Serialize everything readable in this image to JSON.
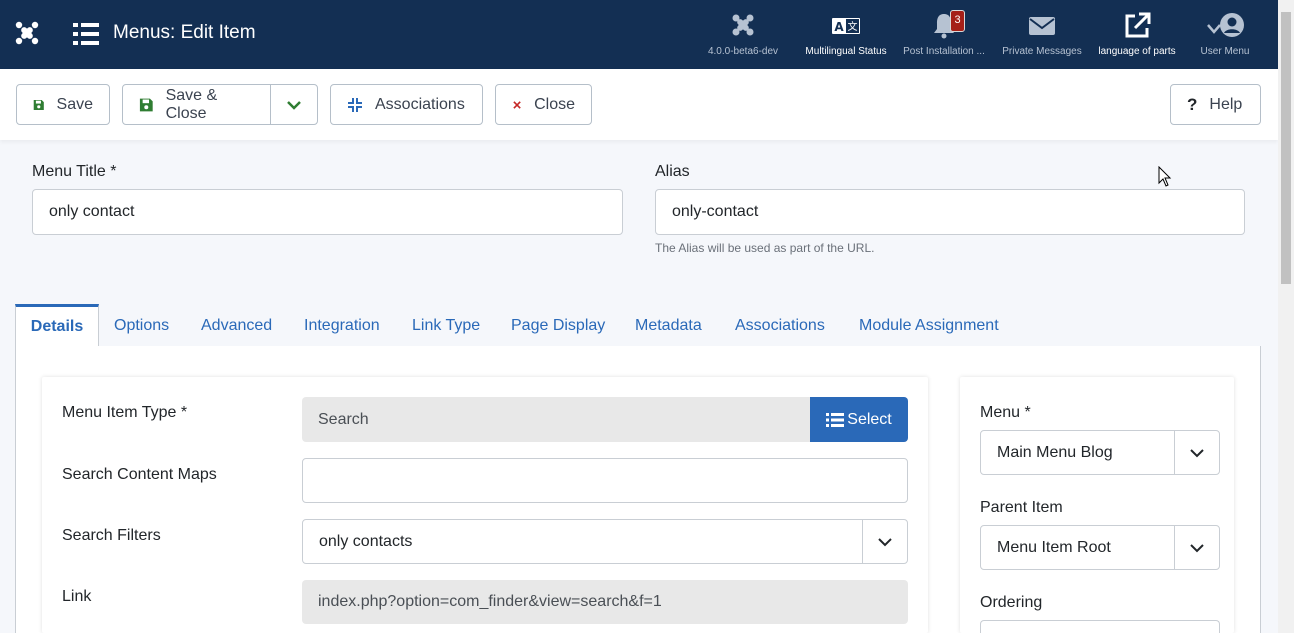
{
  "header": {
    "title": "Menus: Edit Item",
    "items": [
      {
        "label": "4.0.0-beta6-dev",
        "icon": "joomla-icon"
      },
      {
        "label": "Multilingual Status",
        "icon": "language-icon"
      },
      {
        "label": "Post Installation ...",
        "icon": "bell-icon",
        "badge": "3"
      },
      {
        "label": "Private Messages",
        "icon": "envelope-icon"
      },
      {
        "label": "language of parts",
        "icon": "external-link-icon"
      },
      {
        "label": "User Menu",
        "icon": "user-icon"
      }
    ]
  },
  "toolbar": {
    "save": "Save",
    "save_close": "Save & Close",
    "associations": "Associations",
    "close": "Close",
    "help": "Help"
  },
  "form": {
    "menu_title_label": "Menu Title *",
    "menu_title_value": "only contact",
    "alias_label": "Alias",
    "alias_value": "only-contact",
    "alias_help": "The Alias will be used as part of the URL."
  },
  "tabs": [
    "Details",
    "Options",
    "Advanced",
    "Integration",
    "Link Type",
    "Page Display",
    "Metadata",
    "Associations",
    "Module Assignment"
  ],
  "details": {
    "menu_item_type_label": "Menu Item Type *",
    "menu_item_type_value": "Search",
    "select_label": "Select",
    "search_content_maps_label": "Search Content Maps",
    "search_content_maps_value": "",
    "search_filters_label": "Search Filters",
    "search_filters_value": "only contacts",
    "link_label": "Link",
    "link_value": "index.php?option=com_finder&view=search&f=1"
  },
  "side": {
    "menu_label": "Menu *",
    "menu_value": "Main Menu Blog",
    "parent_label": "Parent Item",
    "parent_value": "Menu Item Root",
    "ordering_label": "Ordering"
  },
  "colors": {
    "header_bg": "#132f53",
    "accent": "#2a69b8",
    "save_green": "#2f7d32",
    "close_red": "#c52827"
  }
}
